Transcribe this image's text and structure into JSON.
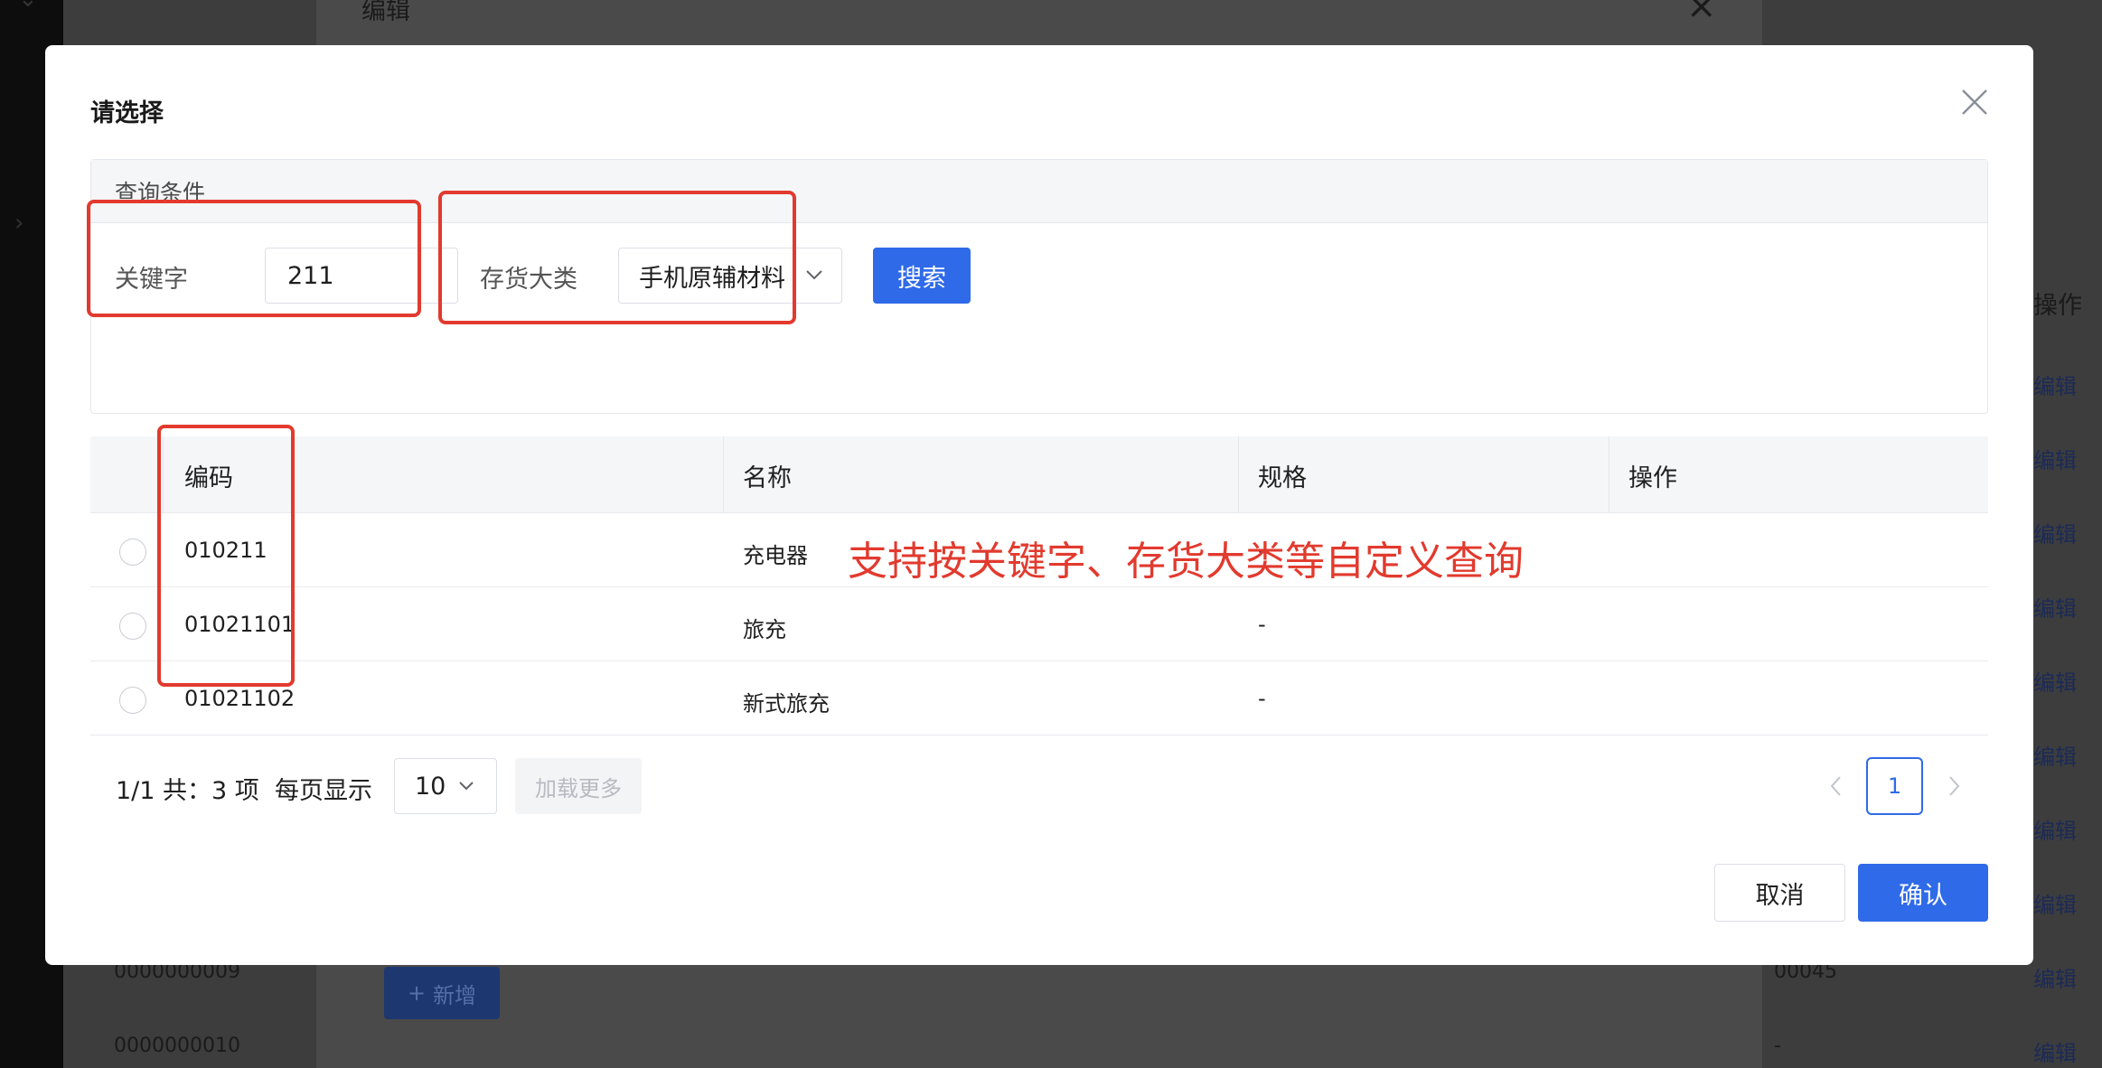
{
  "background": {
    "edit_title": "编辑",
    "col_header": "操作",
    "edit_link": "编辑",
    "codes": [
      "0000000009",
      "0000000010"
    ],
    "add_button": "新增",
    "right_values": [
      "00045",
      "-"
    ]
  },
  "modal": {
    "title": "请选择",
    "close_icon": "close-icon"
  },
  "query": {
    "panel_title": "查询条件",
    "keyword_label": "关键字",
    "keyword_value": "211",
    "category_label": "存货大类",
    "category_value": "手机原辅材料",
    "search_button": "搜索"
  },
  "table": {
    "columns": [
      "编码",
      "名称",
      "规格",
      "操作"
    ],
    "rows": [
      {
        "code": "010211",
        "name": "充电器",
        "spec": "-",
        "action": ""
      },
      {
        "code": "01021101",
        "name": "旅充",
        "spec": "-",
        "action": ""
      },
      {
        "code": "01021102",
        "name": "新式旅充",
        "spec": "-",
        "action": ""
      }
    ]
  },
  "pagination": {
    "info": "1/1 共：3 项",
    "per_page_label": "每页显示",
    "page_size": "10",
    "load_more": "加载更多",
    "current_page": "1"
  },
  "footer": {
    "cancel": "取消",
    "confirm": "确认"
  },
  "annotation": {
    "text": "支持按关键字、存货大类等自定义查询",
    "color": "#e23a2e"
  },
  "colors": {
    "primary": "#2f6ae8",
    "annotation": "#e23a2e"
  }
}
